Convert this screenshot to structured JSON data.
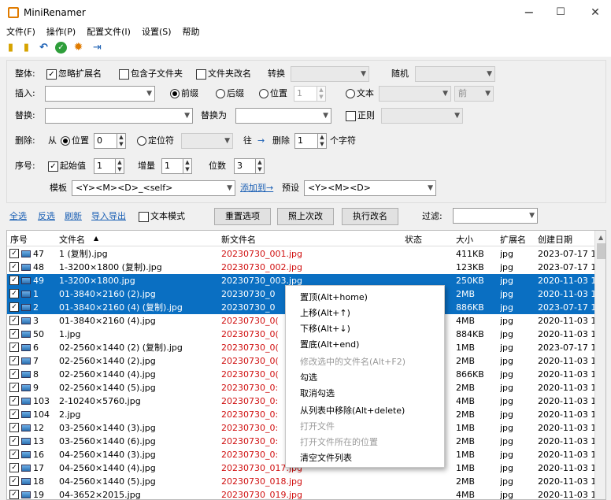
{
  "window": {
    "title": "MiniRenamer",
    "min": "−",
    "max": "☐",
    "close": "✕"
  },
  "menu": [
    "文件(F)",
    "操作(P)",
    "配置文件(I)",
    "设置(S)",
    "帮助"
  ],
  "toolbar": [
    "copy-icon",
    "paste-icon",
    "undo-icon",
    "check-icon",
    "gear-icon",
    "pin-icon"
  ],
  "whole": {
    "label": "整体:",
    "ignore_ext": "忽略扩展名",
    "include_sub": "包含子文件夹",
    "folder_rename": "文件夹改名",
    "convert": "转换",
    "random": "随机"
  },
  "insert": {
    "label": "插入:",
    "prefix": "前缀",
    "suffix": "后缀",
    "position": "位置",
    "pos_val": "1",
    "text": "文本",
    "front": "前"
  },
  "replace": {
    "label": "替换:",
    "with": "替换为",
    "regex": "正则"
  },
  "delete": {
    "label": "删除:",
    "from": "从",
    "position": "位置",
    "pos_val": "0",
    "locator": "定位符",
    "to": "往",
    "arrow": "→",
    "delete": "删除",
    "count": "1",
    "chars": "个字符"
  },
  "seq": {
    "label": "序号:",
    "start": "起始值",
    "start_val": "1",
    "step": "增量",
    "step_val": "1",
    "digits": "位数",
    "digits_val": "3",
    "template_label": "模板",
    "template": "<Y><M><D>_<self>",
    "add_to": "添加到→",
    "preset": "预设",
    "preset_val": "<Y><M><D>"
  },
  "actions": {
    "select_all": "全选",
    "invert": "反选",
    "refresh": "刷新",
    "import_export": "导入导出",
    "text_mode": "文本模式",
    "reset": "重置选项",
    "last": "照上次改",
    "execute": "执行改名",
    "filter": "过滤:"
  },
  "columns": [
    "序号",
    "文件名",
    "新文件名",
    "状态",
    "大小",
    "扩展名",
    "创建日期"
  ],
  "sort_indicator": "▲",
  "rows": [
    {
      "seq": "47",
      "name": "1 (复制).jpg",
      "new": "20230730_001.jpg",
      "size": "411KB",
      "ext": "jpg",
      "date": "2023-07-17 1!",
      "sel": false
    },
    {
      "seq": "48",
      "name": "1-3200×1800 (复制).jpg",
      "new": "20230730_002.jpg",
      "size": "123KB",
      "ext": "jpg",
      "date": "2023-07-17 1!",
      "sel": false
    },
    {
      "seq": "49",
      "name": "1-3200×1800.jpg",
      "new": "20230730_003.jpg",
      "size": "250KB",
      "ext": "jpg",
      "date": "2020-11-03 1-",
      "sel": true
    },
    {
      "seq": "1",
      "name": "01-3840×2160 (2).jpg",
      "new": "20230730_0",
      "size": "2MB",
      "ext": "jpg",
      "date": "2020-11-03 1-",
      "sel": true
    },
    {
      "seq": "2",
      "name": "01-3840×2160 (4) (复制).jpg",
      "new": "20230730_0",
      "size": "886KB",
      "ext": "jpg",
      "date": "2023-07-17 1!",
      "sel": true
    },
    {
      "seq": "3",
      "name": "01-3840×2160 (4).jpg",
      "new": "20230730_0(",
      "size": "4MB",
      "ext": "jpg",
      "date": "2020-11-03 1-",
      "sel": false
    },
    {
      "seq": "50",
      "name": "1.jpg",
      "new": "20230730_0(",
      "size": "884KB",
      "ext": "jpg",
      "date": "2020-11-03 1-",
      "sel": false
    },
    {
      "seq": "6",
      "name": "02-2560×1440 (2) (复制).jpg",
      "new": "20230730_0(",
      "size": "1MB",
      "ext": "jpg",
      "date": "2023-07-17 1!",
      "sel": false
    },
    {
      "seq": "7",
      "name": "02-2560×1440 (2).jpg",
      "new": "20230730_0(",
      "size": "2MB",
      "ext": "jpg",
      "date": "2020-11-03 1-",
      "sel": false
    },
    {
      "seq": "8",
      "name": "02-2560×1440 (4).jpg",
      "new": "20230730_0(",
      "size": "866KB",
      "ext": "jpg",
      "date": "2020-11-03 1-",
      "sel": false
    },
    {
      "seq": "9",
      "name": "02-2560×1440 (5).jpg",
      "new": "20230730_0:",
      "size": "2MB",
      "ext": "jpg",
      "date": "2020-11-03 1-",
      "sel": false
    },
    {
      "seq": "103",
      "name": "2-10240×5760.jpg",
      "new": "20230730_0:",
      "size": "4MB",
      "ext": "jpg",
      "date": "2020-11-03 1-",
      "sel": false
    },
    {
      "seq": "104",
      "name": "2.jpg",
      "new": "20230730_0:",
      "size": "2MB",
      "ext": "jpg",
      "date": "2020-11-03 1-",
      "sel": false
    },
    {
      "seq": "12",
      "name": "03-2560×1440 (3).jpg",
      "new": "20230730_0:",
      "size": "1MB",
      "ext": "jpg",
      "date": "2020-11-03 1-",
      "sel": false
    },
    {
      "seq": "13",
      "name": "03-2560×1440 (6).jpg",
      "new": "20230730_0:",
      "size": "2MB",
      "ext": "jpg",
      "date": "2020-11-03 1-",
      "sel": false
    },
    {
      "seq": "16",
      "name": "04-2560×1440 (3).jpg",
      "new": "20230730_0:",
      "size": "1MB",
      "ext": "jpg",
      "date": "2020-11-03 1-",
      "sel": false
    },
    {
      "seq": "17",
      "name": "04-2560×1440 (4).jpg",
      "new": "20230730_017.jpg",
      "size": "1MB",
      "ext": "jpg",
      "date": "2020-11-03 1-",
      "sel": false
    },
    {
      "seq": "18",
      "name": "04-2560×1440 (5).jpg",
      "new": "20230730_018.jpg",
      "size": "2MB",
      "ext": "jpg",
      "date": "2020-11-03 1-",
      "sel": false
    },
    {
      "seq": "19",
      "name": "04-3652×2015.jpg",
      "new": "20230730_019.jpg",
      "size": "4MB",
      "ext": "jpg",
      "date": "2020-11-03 1-",
      "sel": false
    }
  ],
  "context_menu": [
    {
      "label": "置顶(Alt+home)",
      "enabled": true
    },
    {
      "label": "上移(Alt+↑)",
      "enabled": true
    },
    {
      "label": "下移(Alt+↓)",
      "enabled": true
    },
    {
      "label": "置底(Alt+end)",
      "enabled": true
    },
    {
      "label": "修改选中的文件名(Alt+F2)",
      "enabled": false
    },
    {
      "label": "勾选",
      "enabled": true
    },
    {
      "label": "取消勾选",
      "enabled": true
    },
    {
      "label": "从列表中移除(Alt+delete)",
      "enabled": true
    },
    {
      "label": "打开文件",
      "enabled": false
    },
    {
      "label": "打开文件所在的位置",
      "enabled": false
    },
    {
      "label": "清空文件列表",
      "enabled": true
    }
  ]
}
